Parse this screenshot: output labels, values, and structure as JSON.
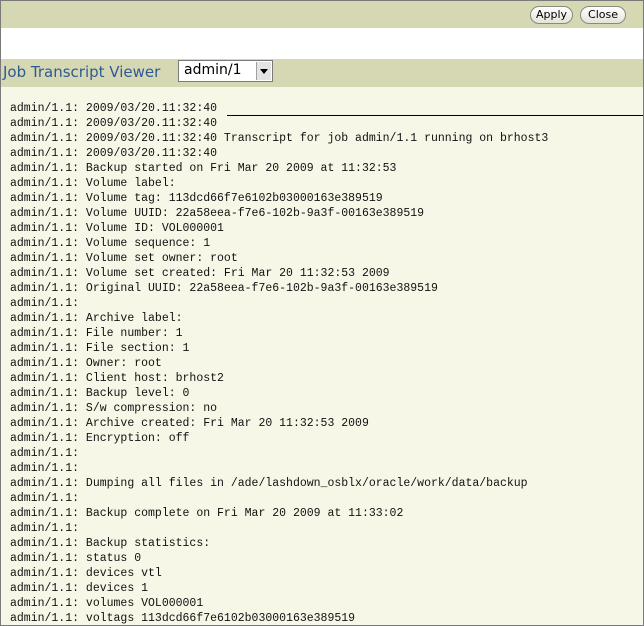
{
  "toolbar": {
    "apply_label": "Apply",
    "close_label": "Close"
  },
  "viewer": {
    "title": "Job Transcript Viewer",
    "selected_job": "admin/1"
  },
  "transcript": {
    "lines": [
      "admin/1.1: 2009/03/20.11:32:40",
      "admin/1.1: 2009/03/20.11:32:40",
      "admin/1.1: 2009/03/20.11:32:40 Transcript for job admin/1.1 running on brhost3",
      "admin/1.1: 2009/03/20.11:32:40",
      "admin/1.1: Backup started on Fri Mar 20 2009 at 11:32:53",
      "admin/1.1: Volume label:",
      "admin/1.1: Volume tag: 113dcd66f7e6102b03000163e389519",
      "admin/1.1: Volume UUID: 22a58eea-f7e6-102b-9a3f-00163e389519",
      "admin/1.1: Volume ID: VOL000001",
      "admin/1.1: Volume sequence: 1",
      "admin/1.1: Volume set owner: root",
      "admin/1.1: Volume set created: Fri Mar 20 11:32:53 2009",
      "admin/1.1: Original UUID: 22a58eea-f7e6-102b-9a3f-00163e389519",
      "admin/1.1:",
      "admin/1.1: Archive label:",
      "admin/1.1: File number: 1",
      "admin/1.1: File section: 1",
      "admin/1.1: Owner: root",
      "admin/1.1: Client host: brhost2",
      "admin/1.1: Backup level: 0",
      "admin/1.1: S/w compression: no",
      "admin/1.1: Archive created: Fri Mar 20 11:32:53 2009",
      "admin/1.1: Encryption: off",
      "admin/1.1:",
      "admin/1.1:",
      "admin/1.1: Dumping all files in /ade/lashdown_osblx/oracle/work/data/backup",
      "admin/1.1:",
      "admin/1.1: Backup complete on Fri Mar 20 2009 at 11:33:02",
      "admin/1.1:",
      "admin/1.1: Backup statistics:",
      "admin/1.1: status 0",
      "admin/1.1: devices vtl",
      "admin/1.1: devices 1",
      "admin/1.1: volumes VOL000001",
      "admin/1.1: voltags 113dcd66f7e6102b03000163e389519"
    ]
  }
}
